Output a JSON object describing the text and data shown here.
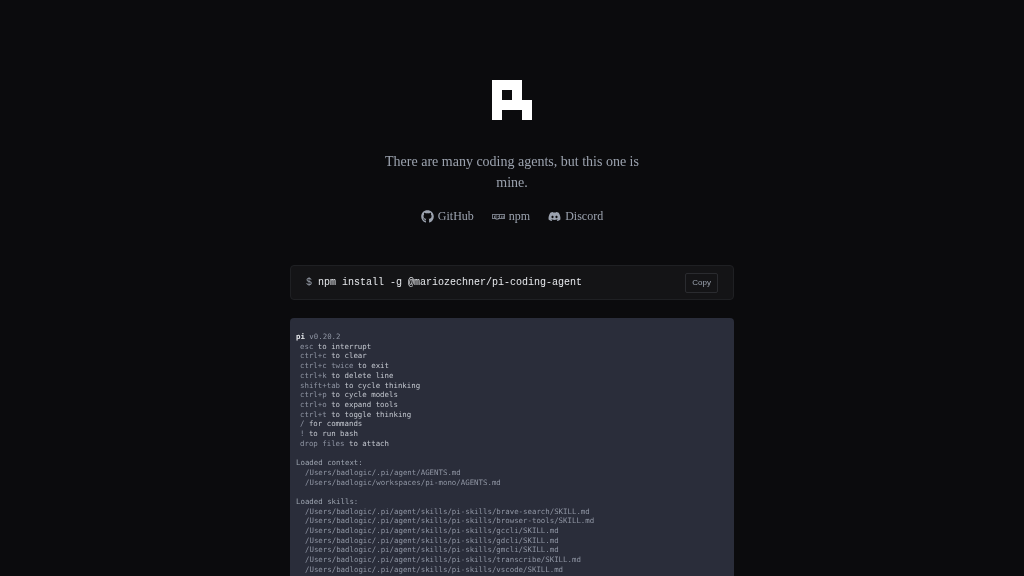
{
  "tagline": "There are many coding agents, but this one is mine.",
  "links": [
    {
      "kind": "github",
      "label": "GitHub"
    },
    {
      "kind": "npm",
      "label": "npm"
    },
    {
      "kind": "discord",
      "label": "Discord"
    }
  ],
  "install": {
    "prompt": "$",
    "command": "npm install -g @mariozechner/pi-coding-agent",
    "copy_label": "Copy"
  },
  "terminal": [
    {
      "kind": "header",
      "name": "pi",
      "version": "v0.20.2"
    },
    {
      "kind": "shortcut",
      "key": "esc",
      "action": "to interrupt"
    },
    {
      "kind": "shortcut",
      "key": "ctrl+c",
      "action": "to clear"
    },
    {
      "kind": "shortcut",
      "key": "ctrl+c twice",
      "action": "to exit"
    },
    {
      "kind": "shortcut",
      "key": "ctrl+k",
      "action": "to delete line"
    },
    {
      "kind": "shortcut",
      "key": "shift+tab",
      "action": "to cycle thinking"
    },
    {
      "kind": "shortcut",
      "key": "ctrl+p",
      "action": "to cycle models"
    },
    {
      "kind": "shortcut",
      "key": "ctrl+o",
      "action": "to expand tools"
    },
    {
      "kind": "shortcut",
      "key": "ctrl+t",
      "action": "to toggle thinking"
    },
    {
      "kind": "shortcut",
      "key": "/",
      "action": "for commands"
    },
    {
      "kind": "shortcut",
      "key": "!",
      "action": "to run bash"
    },
    {
      "kind": "shortcut",
      "key": "drop files",
      "action": "to attach"
    },
    {
      "kind": "blank"
    },
    {
      "kind": "heading",
      "text": "Loaded context:"
    },
    {
      "kind": "path",
      "text": "/Users/badlogic/.pi/agent/AGENTS.md"
    },
    {
      "kind": "path",
      "text": "/Users/badlogic/workspaces/pi-mono/AGENTS.md"
    },
    {
      "kind": "blank"
    },
    {
      "kind": "heading",
      "text": "Loaded skills:"
    },
    {
      "kind": "path",
      "text": "/Users/badlogic/.pi/agent/skills/pi-skills/brave-search/SKILL.md"
    },
    {
      "kind": "path",
      "text": "/Users/badlogic/.pi/agent/skills/pi-skills/browser-tools/SKILL.md"
    },
    {
      "kind": "path",
      "text": "/Users/badlogic/.pi/agent/skills/pi-skills/gccli/SKILL.md"
    },
    {
      "kind": "path",
      "text": "/Users/badlogic/.pi/agent/skills/pi-skills/gdcli/SKILL.md"
    },
    {
      "kind": "path",
      "text": "/Users/badlogic/.pi/agent/skills/pi-skills/gmcli/SKILL.md"
    },
    {
      "kind": "path",
      "text": "/Users/badlogic/.pi/agent/skills/pi-skills/transcribe/SKILL.md"
    },
    {
      "kind": "path",
      "text": "/Users/badlogic/.pi/agent/skills/pi-skills/vscode/SKILL.md"
    }
  ]
}
